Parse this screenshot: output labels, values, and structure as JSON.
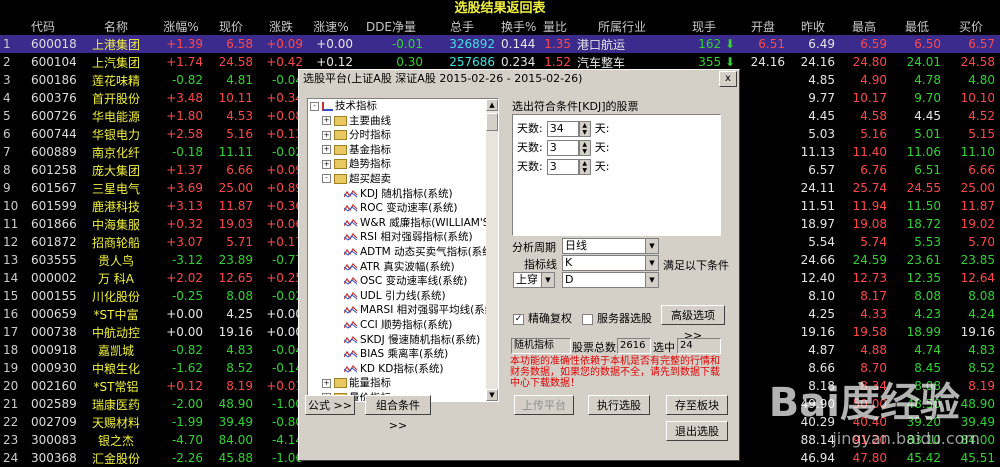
{
  "page_title": "选股结果返回表",
  "columns": [
    "代码",
    "名称",
    "涨幅%",
    "现价",
    "涨跌",
    "涨速%",
    "DDE净量",
    "总手",
    "换手%",
    "量比",
    "所属行业",
    "现手",
    "开盘",
    "昨收",
    "最高",
    "最低",
    "买价",
    "卖价"
  ],
  "rows": [
    {
      "idx": "1",
      "code": "600018",
      "name": "上港集团",
      "chg_pct": "+1.39",
      "price": "6.58",
      "chg": "+0.09",
      "speed": "+0.00",
      "dde": "-0.01",
      "vol": "326892",
      "turnover": "0.144",
      "vol_ratio": "1.35",
      "industry": "港口航运",
      "cur_hand": "162",
      "open": "6.51",
      "prev": "6.49",
      "high": "6.59",
      "low": "6.50",
      "bid": "6.57",
      "ask": "6.58"
    },
    {
      "idx": "2",
      "code": "600104",
      "name": "上汽集团",
      "chg_pct": "+1.74",
      "price": "24.58",
      "chg": "+0.42",
      "speed": "+0.12",
      "dde": "0.30",
      "vol": "257686",
      "turnover": "0.234",
      "vol_ratio": "1.52",
      "industry": "汽车整车",
      "cur_hand": "355",
      "open": "24.16",
      "prev": "24.16",
      "high": "24.80",
      "low": "24.01",
      "bid": "24.58",
      "ask": "24.59"
    },
    {
      "idx": "3",
      "code": "600186",
      "name": "莲花味精",
      "chg_pct": "-0.82",
      "price": "4.81",
      "chg": "-0.04",
      "prev": "4.85",
      "high": "4.90",
      "low": "4.78",
      "bid": "4.80",
      "ask": "4.81"
    },
    {
      "idx": "4",
      "code": "600376",
      "name": "首开股份",
      "chg_pct": "+3.48",
      "price": "10.11",
      "chg": "+0.34",
      "prev": "9.77",
      "high": "10.17",
      "low": "9.70",
      "bid": "10.10",
      "ask": "10.11"
    },
    {
      "idx": "5",
      "code": "600726",
      "name": "华电能源",
      "chg_pct": "+1.80",
      "price": "4.53",
      "chg": "+0.08",
      "prev": "4.45",
      "high": "4.58",
      "low": "4.45",
      "bid": "4.52",
      "ask": "4.53"
    },
    {
      "idx": "6",
      "code": "600744",
      "name": "华银电力",
      "chg_pct": "+2.58",
      "price": "5.16",
      "chg": "+0.13",
      "prev": "5.03",
      "high": "5.16",
      "low": "5.01",
      "bid": "5.15",
      "ask": "5.16"
    },
    {
      "idx": "7",
      "code": "600889",
      "name": "南京化纤",
      "chg_pct": "-0.18",
      "price": "11.11",
      "chg": "-0.02",
      "prev": "11.13",
      "high": "11.40",
      "low": "11.06",
      "bid": "11.10",
      "ask": "11.11"
    },
    {
      "idx": "8",
      "code": "601258",
      "name": "庞大集团",
      "chg_pct": "+1.37",
      "price": "6.66",
      "chg": "+0.09",
      "prev": "6.57",
      "high": "6.76",
      "low": "6.51",
      "bid": "6.66",
      "ask": "6.67"
    },
    {
      "idx": "9",
      "code": "601567",
      "name": "三星电气",
      "chg_pct": "+3.69",
      "price": "25.00",
      "chg": "+0.89",
      "prev": "24.11",
      "high": "25.74",
      "low": "24.55",
      "bid": "25.00",
      "ask": "25.09"
    },
    {
      "idx": "10",
      "code": "601599",
      "name": "鹿港科技",
      "chg_pct": "+3.13",
      "price": "11.87",
      "chg": "+0.36",
      "prev": "11.51",
      "high": "11.94",
      "low": "11.50",
      "bid": "11.87",
      "ask": "11.88"
    },
    {
      "idx": "11",
      "code": "601866",
      "name": "中海集服",
      "chg_pct": "+0.32",
      "price": "19.03",
      "chg": "+0.06",
      "prev": "18.97",
      "high": "19.08",
      "low": "18.72",
      "bid": "19.02",
      "ask": "19.03"
    },
    {
      "idx": "12",
      "code": "601872",
      "name": "招商轮船",
      "chg_pct": "+3.07",
      "price": "5.71",
      "chg": "+0.17",
      "prev": "5.54",
      "high": "5.74",
      "low": "5.53",
      "bid": "5.70",
      "ask": "5.71"
    },
    {
      "idx": "13",
      "code": "603555",
      "name": "贵人鸟",
      "chg_pct": "-3.12",
      "price": "23.89",
      "chg": "-0.77",
      "prev": "24.66",
      "high": "24.59",
      "low": "23.61",
      "bid": "23.85",
      "ask": "23.89"
    },
    {
      "idx": "14",
      "code": "000002",
      "name": "万 科A",
      "chg_pct": "+2.02",
      "price": "12.65",
      "chg": "+0.25",
      "prev": "12.40",
      "high": "12.73",
      "low": "12.35",
      "bid": "12.64",
      "ask": "12.65"
    },
    {
      "idx": "15",
      "code": "000155",
      "name": "川化股份",
      "chg_pct": "-0.25",
      "price": "8.08",
      "chg": "-0.02",
      "prev": "8.10",
      "high": "8.17",
      "low": "8.08",
      "bid": "8.08",
      "ask": "8.09"
    },
    {
      "idx": "16",
      "code": "000659",
      "name": "*ST中富",
      "chg_pct": "+0.00",
      "price": "4.25",
      "chg": "+0.00",
      "prev": "4.25",
      "high": "4.33",
      "low": "4.23",
      "bid": "4.24",
      "ask": "4.25"
    },
    {
      "idx": "17",
      "code": "000738",
      "name": "中航动控",
      "chg_pct": "+0.00",
      "price": "19.16",
      "chg": "+0.00",
      "prev": "19.16",
      "high": "19.58",
      "low": "18.99",
      "bid": "19.16",
      "ask": "19.17"
    },
    {
      "idx": "18",
      "code": "000918",
      "name": "嘉凯城",
      "chg_pct": "-0.82",
      "price": "4.83",
      "chg": "-0.04",
      "prev": "4.87",
      "high": "4.88",
      "low": "4.74",
      "bid": "4.83",
      "ask": "4.84"
    },
    {
      "idx": "19",
      "code": "000930",
      "name": "中粮生化",
      "chg_pct": "-1.62",
      "price": "8.52",
      "chg": "-0.14",
      "prev": "8.66",
      "high": "8.70",
      "low": "8.45",
      "bid": "8.52",
      "ask": "8.53"
    },
    {
      "idx": "20",
      "code": "002160",
      "name": "*ST常铝",
      "chg_pct": "+0.12",
      "price": "8.19",
      "chg": "+0.01",
      "prev": "8.18",
      "high": "8.34",
      "low": "8.08",
      "bid": "8.19",
      "ask": "8.20"
    },
    {
      "idx": "21",
      "code": "002589",
      "name": "瑞康医药",
      "chg_pct": "-2.00",
      "price": "48.90",
      "chg": "-1.00",
      "prev": "49.90",
      "high": "50.00",
      "low": "48.50",
      "bid": "48.90",
      "ask": "48.91"
    },
    {
      "idx": "22",
      "code": "002709",
      "name": "天赐材料",
      "chg_pct": "-1.99",
      "price": "39.49",
      "chg": "-0.80",
      "prev": "40.29",
      "high": "40.40",
      "low": "39.20",
      "bid": "39.49",
      "ask": "39.50"
    },
    {
      "idx": "23",
      "code": "300083",
      "name": "银之杰",
      "chg_pct": "-4.70",
      "price": "84.00",
      "chg": "-4.14",
      "prev": "88.14",
      "high": "91.20",
      "low": "83.10",
      "bid": "84.00",
      "ask": "84.01"
    },
    {
      "idx": "24",
      "code": "300368",
      "name": "汇金股份",
      "chg_pct": "-2.26",
      "price": "45.88",
      "chg": "-1.06",
      "prev": "46.94",
      "high": "47.80",
      "low": "45.42",
      "bid": "45.51",
      "ask": "45.88"
    }
  ],
  "dialog": {
    "title": "选股平台(上证A股 深证A股  2015-02-26 - 2015-02-26)",
    "close_label": "x",
    "tree": {
      "root": "技术指标",
      "groups": [
        "主要曲线",
        "分时指标",
        "基金指标",
        "趋势指标"
      ],
      "open_group": "超买超卖",
      "items": [
        "KDJ 随机指标(系统)",
        "ROC 变动速率(系统)",
        "W&R 威廉指标(WILLIAM'S %R)",
        "RSI 相对强弱指标(系统)",
        "ADTM 动态买卖气指标(系统)",
        "ATR 真实波幅(系统)",
        "OSC 变动速率线(系统)",
        "UDL 引力线(系统)",
        "MARSI 相对强弱平均线(系统)",
        "CCI 顺势指标(系统)",
        "SKDJ 慢速随机指标(系统)",
        "BIAS 乘离率(系统)",
        "KD KD指标(系统)"
      ],
      "tail_groups": [
        "能量指标",
        "量价指标"
      ]
    },
    "condition_title": "选出符合条件[KDJ]的股票",
    "params": [
      {
        "label": "天数:",
        "value": "34",
        "unit": "天:"
      },
      {
        "label": "天数:",
        "value": "3",
        "unit": "天:"
      },
      {
        "label": "天数:",
        "value": "3",
        "unit": "天:"
      }
    ],
    "period_label": "分析周期",
    "period_value": "日线",
    "indicator_label": "指标线",
    "indicator_value": "K",
    "condition_suffix": "满足以下条件",
    "cross_value": "上穿",
    "cross_target": "D",
    "adjust_label": "精确复权",
    "server_label": "服务器选股",
    "advanced_btn": "高级选项 >>",
    "status_name": "随机指标",
    "total_label": "股票总数",
    "total_value": "2616",
    "picked_label": "选中",
    "picked_value": "24",
    "warning": "本功能的准确性依赖于本机是否有完整的行情和财务数据，如果您的数据不全，请先到数据下载中心下载数据！",
    "formula_btn": "公式 >>",
    "combo_btn": "组合条件 >>",
    "upload_btn": "上传平台",
    "exec_btn": "执行选股",
    "save_btn": "存至板块",
    "exit_btn": "退出选股"
  },
  "watermark": {
    "brand": "Bai度经验",
    "url": "jingyan.baidu.com"
  }
}
